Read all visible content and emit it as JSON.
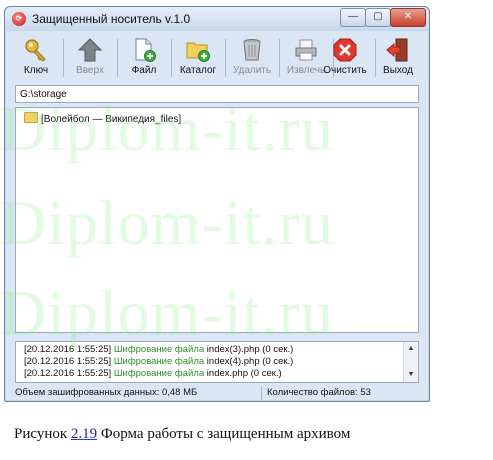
{
  "window": {
    "title": "Защищенный носитель v.1.0",
    "app_icon_glyph": "⟳",
    "controls": {
      "minimize": "—",
      "maximize": "▢",
      "close": "✕"
    }
  },
  "toolbar": {
    "items": [
      {
        "label": "Ключ",
        "icon": "key-icon",
        "enabled": true
      },
      {
        "label": "Вверх",
        "icon": "arrow-up-icon",
        "enabled": false
      },
      {
        "label": "Файл",
        "icon": "add-file-icon",
        "enabled": true
      },
      {
        "label": "Каталог",
        "icon": "add-folder-icon",
        "enabled": true
      },
      {
        "label": "Удалить",
        "icon": "trash-icon",
        "enabled": false
      },
      {
        "label": "Извлечь",
        "icon": "extract-printer-icon",
        "enabled": false
      },
      {
        "label": "Очистить",
        "icon": "clear-icon",
        "enabled": true
      },
      {
        "label": "Выход",
        "icon": "exit-icon",
        "enabled": true
      }
    ]
  },
  "path": {
    "value": "G:\\storage"
  },
  "files": [
    {
      "name": "[Волейбол — Википедия_files]",
      "icon": "folder-icon"
    }
  ],
  "log": [
    {
      "time": "[20.12.2016 1:55:25]",
      "action": "Шифрование файла",
      "file": "index(3).php (0 сек.)"
    },
    {
      "time": "[20.12.2016 1:55:25]",
      "action": "Шифрование файла",
      "file": "index(4).php (0 сек.)"
    },
    {
      "time": "[20.12.2016 1:55:25]",
      "action": "Шифрование файла",
      "file": "index.php (0 сек.)"
    }
  ],
  "status": {
    "encrypted_volume": "Объем зашифрованных данных: 0,48 МБ",
    "file_count": "Количество файлов: 53"
  },
  "watermark": {
    "text": "Diplom-it.ru"
  },
  "caption": {
    "prefix": "Рисунок",
    "number": "2.19",
    "text": "Форма работы с защищенным архивом"
  },
  "colors": {
    "window_bg": "#dbe6f4",
    "log_action": "#2f8f2a",
    "watermark": "#78eb78"
  }
}
